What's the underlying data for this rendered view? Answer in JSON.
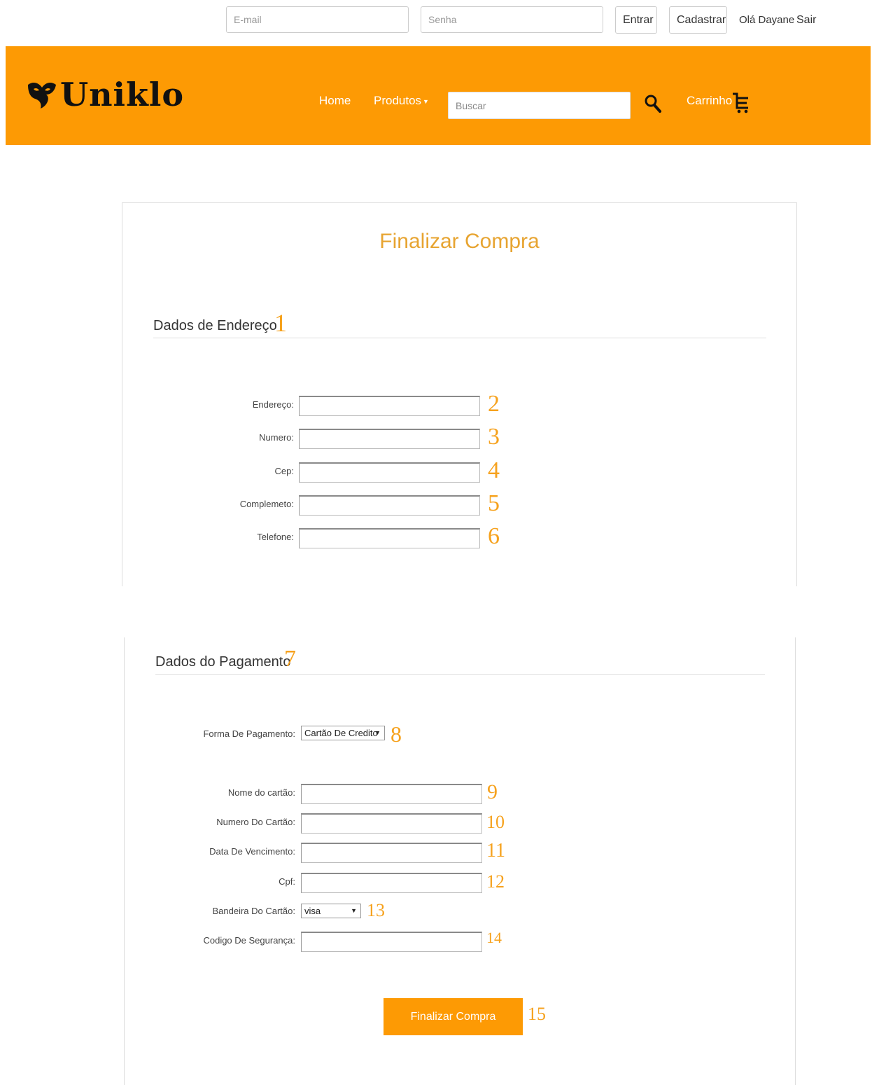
{
  "topbar": {
    "email_placeholder": "E-mail",
    "password_placeholder": "Senha",
    "login_label": "Entrar",
    "register_label": "Cadastrar",
    "greeting": "Olá Dayane",
    "logout_label": "Sair"
  },
  "header": {
    "brand": "Uniklo",
    "nav": {
      "home": "Home",
      "products": "Produtos",
      "cart": "Carrinho"
    },
    "search_placeholder": "Buscar",
    "color": "#fd9a04"
  },
  "checkout": {
    "title": "Finalizar Compra",
    "address_section": {
      "title": "Dados de Endereço",
      "number": "1"
    },
    "address_fields": [
      {
        "label": "Endereço:",
        "number": "2"
      },
      {
        "label": "Numero:",
        "number": "3"
      },
      {
        "label": "Cep:",
        "number": "4"
      },
      {
        "label": "Complemeto:",
        "number": "5"
      },
      {
        "label": "Telefone:",
        "number": "6"
      }
    ],
    "payment_section": {
      "title": "Dados do Pagamento",
      "number": "7"
    },
    "payment_method": {
      "label": "Forma De Pagamento:",
      "value": "Cartão De Credito",
      "number": "8"
    },
    "card_fields": [
      {
        "label": "Nome do cartão:",
        "number": "9"
      },
      {
        "label": "Numero Do Cartão:",
        "number": "10"
      },
      {
        "label": "Data De Vencimento:",
        "number": "11"
      },
      {
        "label": "Cpf:",
        "number": "12"
      }
    ],
    "card_brand": {
      "label": "Bandeira Do Cartão:",
      "value": "visa",
      "number": "13"
    },
    "security_code": {
      "label": "Codigo De Segurança:",
      "number": "14"
    },
    "submit": {
      "label": "Finalizar Compra",
      "number": "15"
    }
  }
}
